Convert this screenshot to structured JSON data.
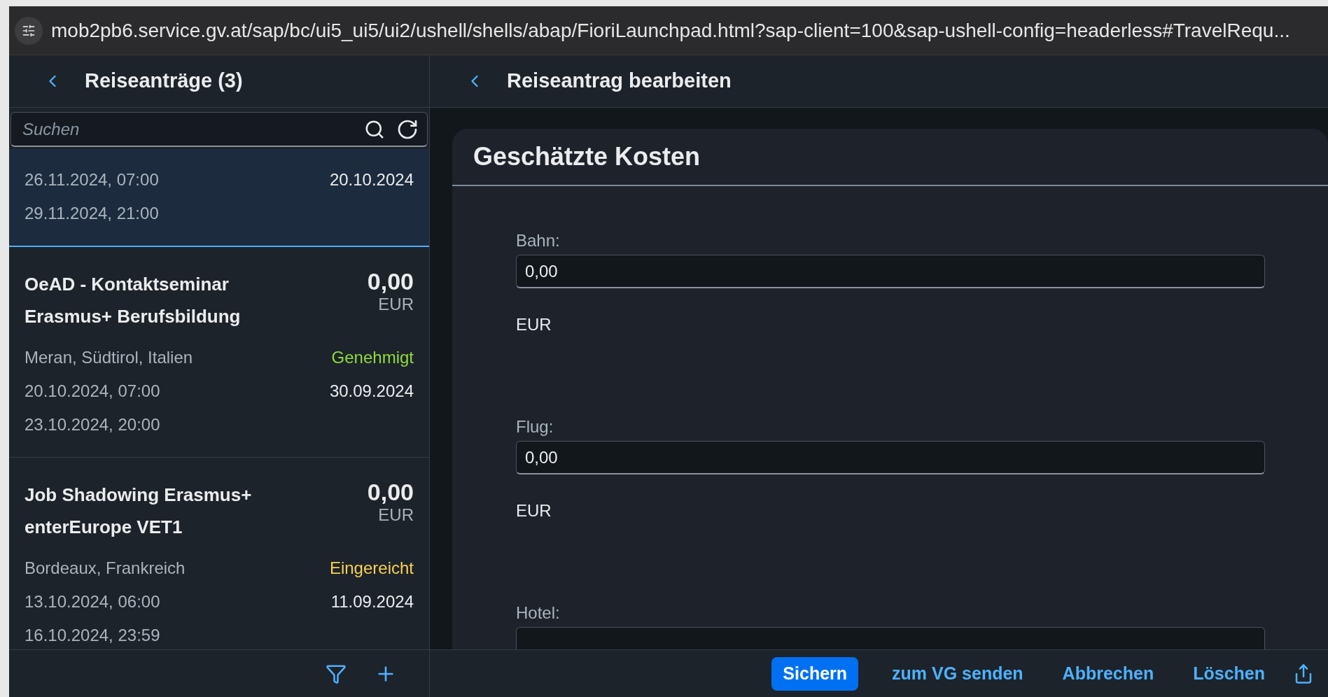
{
  "address_bar": {
    "url": "mob2pb6.service.gv.at/sap/bc/ui5_ui5/ui2/ushell/shells/abap/FioriLaunchpad.html?sap-client=100&sap-ushell-config=headerless#TravelRequ..."
  },
  "list_panel": {
    "title": "Reiseanträge (3)",
    "search": {
      "placeholder": "Suchen"
    },
    "items": [
      {
        "selected": true,
        "start": "26.11.2024, 07:00",
        "end": "29.11.2024, 21:00",
        "created": "20.10.2024"
      },
      {
        "selected": false,
        "title": "OeAD - Kontaktseminar Erasmus+ Berufsbildung",
        "amount": "0,00",
        "currency": "EUR",
        "location": "Meran, Südtirol, Italien",
        "status": {
          "text": "Genehmigt",
          "kind": "approved"
        },
        "start": "20.10.2024, 07:00",
        "end": "23.10.2024, 20:00",
        "created": "30.09.2024"
      },
      {
        "selected": false,
        "title": "Job Shadowing Erasmus+ enterEurope VET1",
        "amount": "0,00",
        "currency": "EUR",
        "location": "Bordeaux, Frankreich",
        "status": {
          "text": "Eingereicht",
          "kind": "submitted"
        },
        "start": "13.10.2024, 06:00",
        "end": "16.10.2024, 23:59",
        "created": "11.09.2024"
      }
    ]
  },
  "detail_panel": {
    "title": "Reiseantrag bearbeiten",
    "section_title": "Geschätzte Kosten",
    "fields": [
      {
        "label": "Bahn:",
        "value": "0,00",
        "unit": "EUR"
      },
      {
        "label": "Flug:",
        "value": "0,00",
        "unit": "EUR"
      },
      {
        "label": "Hotel:"
      }
    ]
  },
  "footer": {
    "buttons": [
      {
        "label": "Sichern",
        "kind": "primary"
      },
      {
        "label": "zum VG senden",
        "kind": "link"
      },
      {
        "label": "Abbrechen",
        "kind": "link"
      },
      {
        "label": "Löschen",
        "kind": "link"
      }
    ]
  }
}
